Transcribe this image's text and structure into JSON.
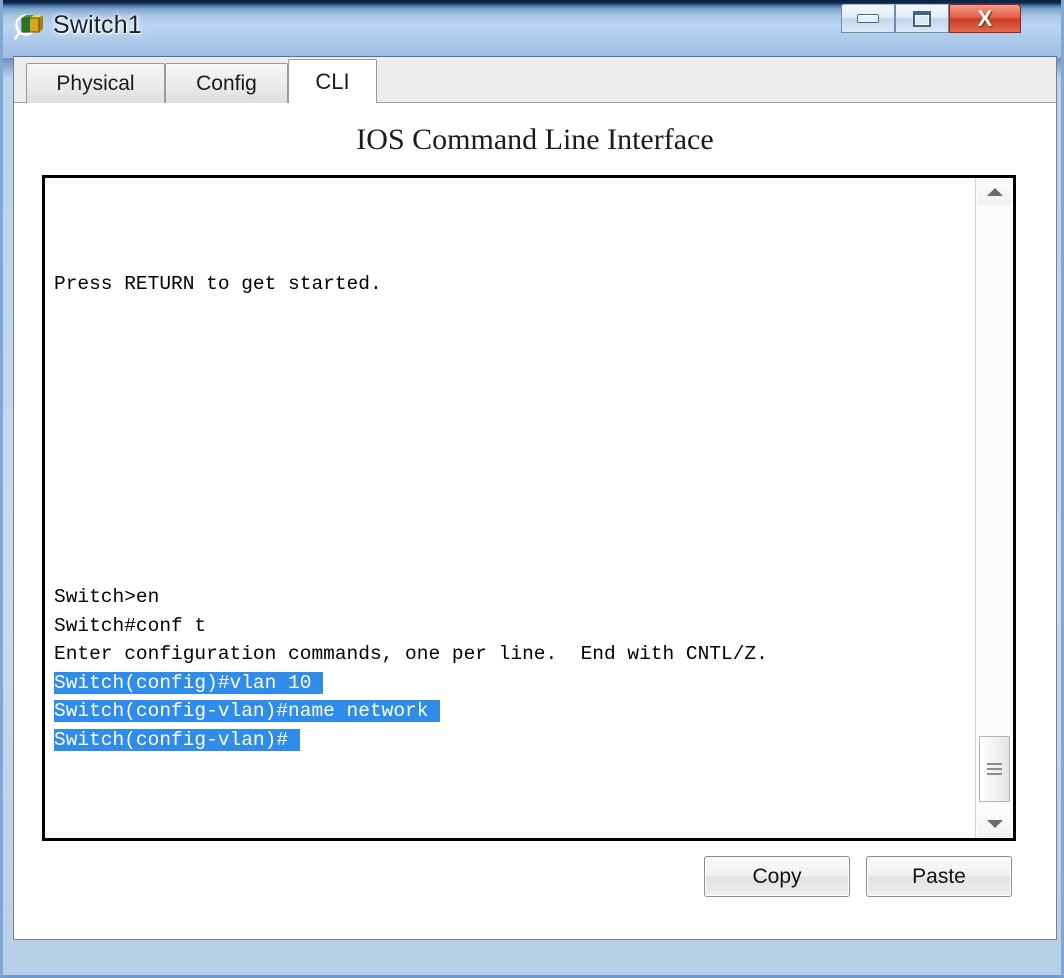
{
  "window": {
    "title": "Switch1",
    "icon": "packet-tracer-device-icon",
    "controls": {
      "minimize": "minimize-icon",
      "maximize": "maximize-icon",
      "close": "X"
    }
  },
  "tabs": [
    {
      "label": "Physical",
      "active": false
    },
    {
      "label": "Config",
      "active": false
    },
    {
      "label": "CLI",
      "active": true
    }
  ],
  "page": {
    "heading": "IOS Command Line Interface"
  },
  "terminal": {
    "lines": [
      {
        "text": "",
        "selected": false
      },
      {
        "text": "",
        "selected": false
      },
      {
        "text": "",
        "selected": false
      },
      {
        "text": "Press RETURN to get started.",
        "selected": false
      },
      {
        "text": "",
        "selected": false
      },
      {
        "text": "",
        "selected": false
      },
      {
        "text": "",
        "selected": false
      },
      {
        "text": "",
        "selected": false
      },
      {
        "text": "",
        "selected": false
      },
      {
        "text": "",
        "selected": false
      },
      {
        "text": "",
        "selected": false
      },
      {
        "text": "",
        "selected": false
      },
      {
        "text": "",
        "selected": false
      },
      {
        "text": "",
        "selected": false
      },
      {
        "text": "Switch>en",
        "selected": false
      },
      {
        "text": "Switch#conf t",
        "selected": false
      },
      {
        "text": "Enter configuration commands, one per line.  End with CNTL/Z.",
        "selected": false
      },
      {
        "text": "Switch(config)#vlan 10 ",
        "selected": true
      },
      {
        "text": "Switch(config-vlan)#name network ",
        "selected": true
      },
      {
        "text": "Switch(config-vlan)# ",
        "selected": true
      }
    ]
  },
  "scrollbar": {
    "up_arrow": "scroll-up-icon",
    "down_arrow": "scroll-down-icon",
    "thumb": "scrollbar-thumb"
  },
  "actions": {
    "copy_label": "Copy",
    "paste_label": "Paste"
  },
  "colors": {
    "selection_blue": "#2f8ce8",
    "titlebar_blue": "#bcd5ef",
    "close_red": "#c93c22",
    "terminal_bg": "#ffffff",
    "terminal_fg": "#000000"
  }
}
